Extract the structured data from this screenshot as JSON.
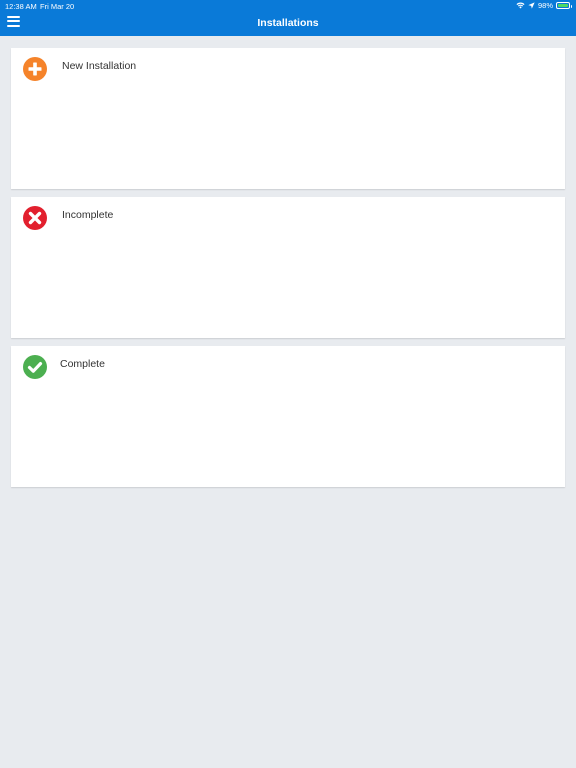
{
  "status_bar": {
    "time": "12:38 AM",
    "date": "Fri Mar 20",
    "battery_percent": "98%",
    "icons": [
      "wifi-icon",
      "location-arrow-icon",
      "battery-icon"
    ]
  },
  "header": {
    "title": "Installations",
    "menu_icon": "hamburger-menu-icon",
    "background_color": "#0a7ad8"
  },
  "cards": [
    {
      "label": "New Installation",
      "icon": "plus-circle-icon",
      "icon_color": "#f5832a"
    },
    {
      "label": "Incomplete",
      "icon": "x-circle-icon",
      "icon_color": "#e2202e"
    },
    {
      "label": "Complete",
      "icon": "check-circle-icon",
      "icon_color": "#4caf50"
    }
  ]
}
